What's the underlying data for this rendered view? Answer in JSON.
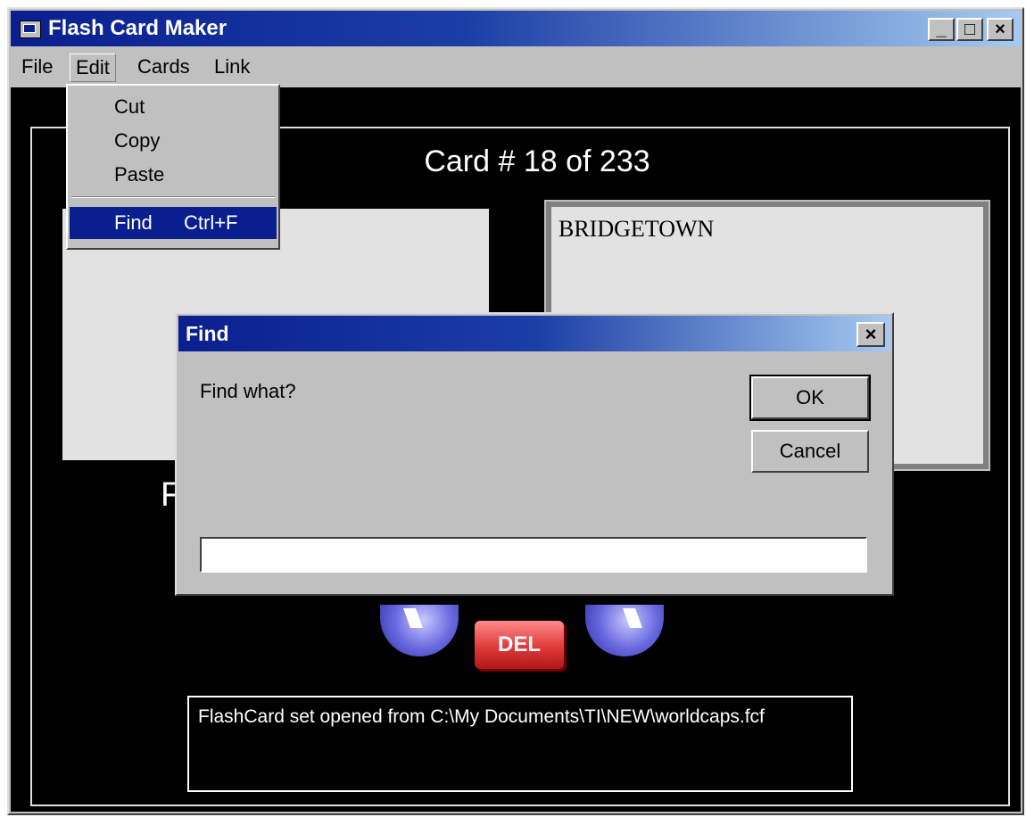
{
  "window": {
    "title": "Flash Card Maker",
    "controls": {
      "minimize": "_",
      "maximize": "□",
      "close": "×"
    }
  },
  "menubar": {
    "items": [
      "File",
      "Edit",
      "Cards",
      "Link"
    ]
  },
  "edit_menu": {
    "items": [
      {
        "label": "Cut",
        "shortcut": ""
      },
      {
        "label": "Copy",
        "shortcut": ""
      },
      {
        "label": "Paste",
        "shortcut": ""
      },
      {
        "label": "Find",
        "shortcut": "Ctrl+F"
      }
    ],
    "selected_item": "Find"
  },
  "main": {
    "card_counter": "Card # 18 of 233",
    "back_card_text": "BRIDGETOWN",
    "front_card_text": "",
    "partial_label": "F",
    "delete_button": "DEL",
    "status_text": "FlashCard set opened from C:\\My Documents\\TI\\NEW\\worldcaps.fcf"
  },
  "find_dialog": {
    "title": "Find",
    "close_glyph": "×",
    "prompt": "Find what?",
    "ok_label": "OK",
    "cancel_label": "Cancel",
    "input_value": ""
  },
  "colors": {
    "titlebar_start": "#0a1f8f",
    "titlebar_end": "#a6caf0",
    "face": "#c0c0c0",
    "client_background": "#000000",
    "selection": "#0a1f8f",
    "delete_button": "#e03a3a",
    "nav_buttons": "#6a6ae0"
  }
}
